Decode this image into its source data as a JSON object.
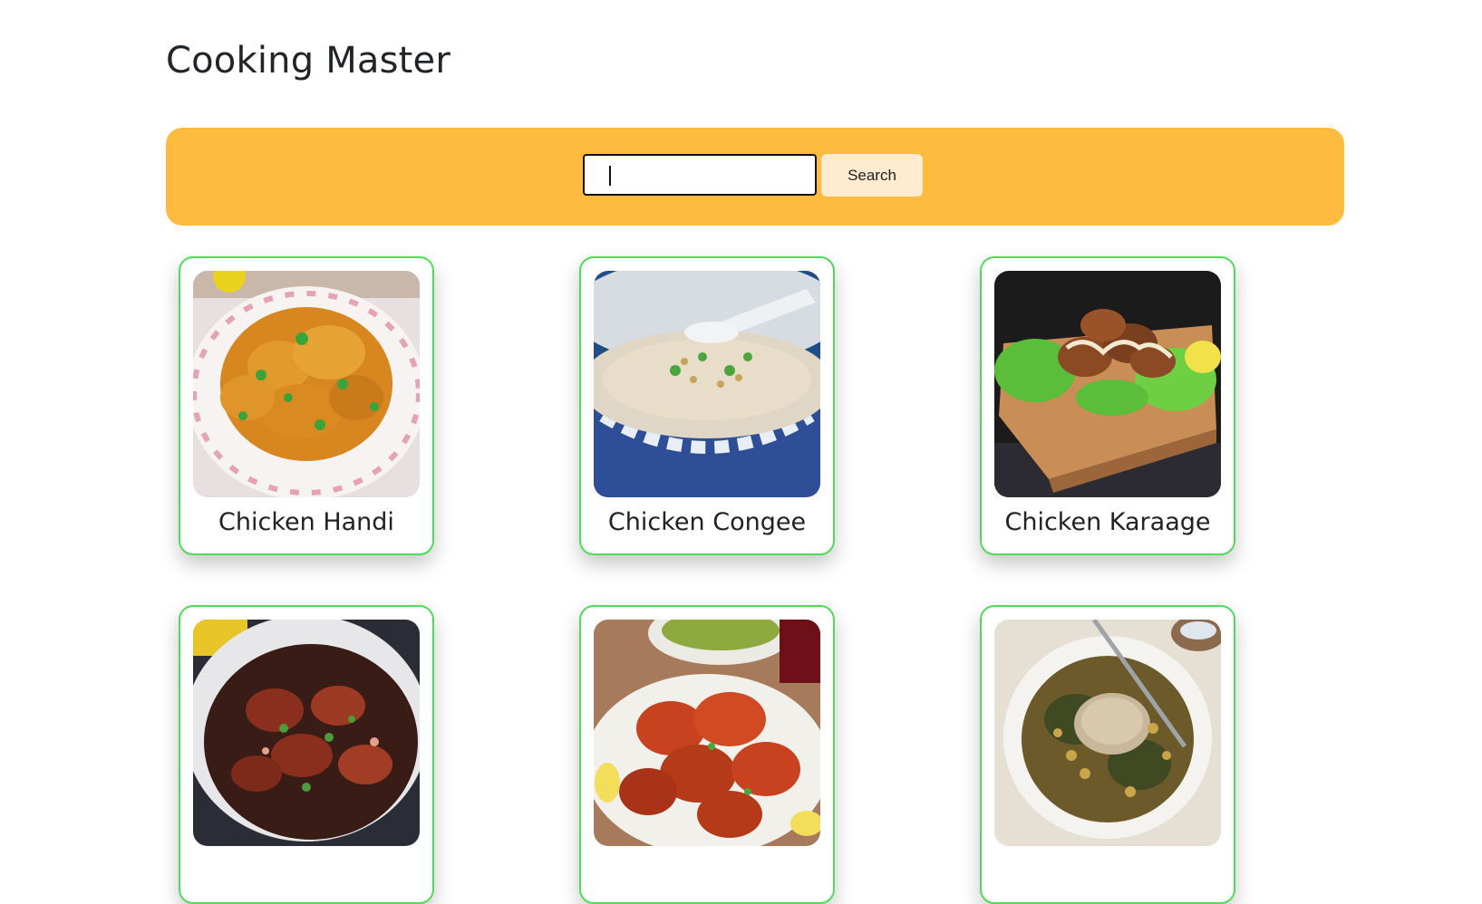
{
  "app": {
    "title": "Cooking Master"
  },
  "search": {
    "value": "",
    "placeholder": "",
    "button_label": "Search"
  },
  "colors": {
    "search_bar_bg": "#ffbb3e",
    "search_button_bg": "#ffebcf",
    "card_border": "#4fdc5b"
  },
  "meals": [
    {
      "name": "Chicken Handi",
      "image_icon": "chicken-handi-photo"
    },
    {
      "name": "Chicken Congee",
      "image_icon": "chicken-congee-photo"
    },
    {
      "name": "Chicken Karaage",
      "image_icon": "chicken-karaage-photo"
    },
    {
      "name": "",
      "image_icon": "chicken-stew-pot-photo"
    },
    {
      "name": "",
      "image_icon": "tandoori-chicken-photo"
    },
    {
      "name": "",
      "image_icon": "chicken-bean-bowl-photo"
    }
  ]
}
